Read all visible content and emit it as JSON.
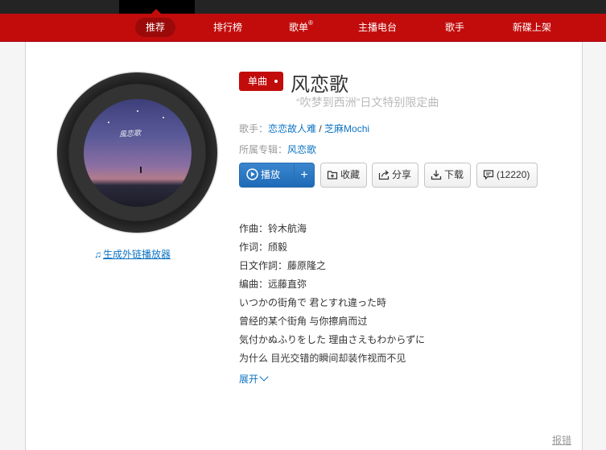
{
  "nav": {
    "items": [
      {
        "label": "推荐",
        "selected": true
      },
      {
        "label": "排行榜",
        "selected": false
      },
      {
        "label": "歌单",
        "selected": false
      },
      {
        "label": "主播电台",
        "selected": false
      },
      {
        "label": "歌手",
        "selected": false
      },
      {
        "label": "新碟上架",
        "selected": false
      }
    ],
    "playlist_sup": "®"
  },
  "colors": {
    "brand_red": "#c20c0c",
    "link_blue": "#0c73c2",
    "play_blue": "#1d6ab7"
  },
  "cover": {
    "art_text": "風恋歌"
  },
  "player_link": {
    "icon": "music-note-icon",
    "label": "生成外链播放器"
  },
  "song": {
    "badge": "单曲",
    "title": "风恋歌",
    "subtitle": "“吹梦到西洲”日文特别限定曲",
    "artist_label": "歌手：",
    "artists": [
      "恋恋故人难",
      "芝麻Mochi"
    ],
    "artist_sep": " / ",
    "album_label": "所属专辑：",
    "album": "风恋歌"
  },
  "actions": {
    "play": "播放",
    "add": "+",
    "favorite": "收藏",
    "share": "分享",
    "download": "下载",
    "comments": "(12220)"
  },
  "lyrics": [
    "作曲：铃木航海",
    "作词：颀毅",
    "日文作詞：藤原隆之",
    "编曲：远藤直弥",
    "いつかの街角で 君とすれ違った時",
    "曾经的某个街角 与你擦肩而过",
    "気付かぬふりをした 理由さえもわからずに",
    "为什么 目光交错的瞬间却装作视而不见"
  ],
  "expand_label": "展开",
  "report_label": "报错"
}
